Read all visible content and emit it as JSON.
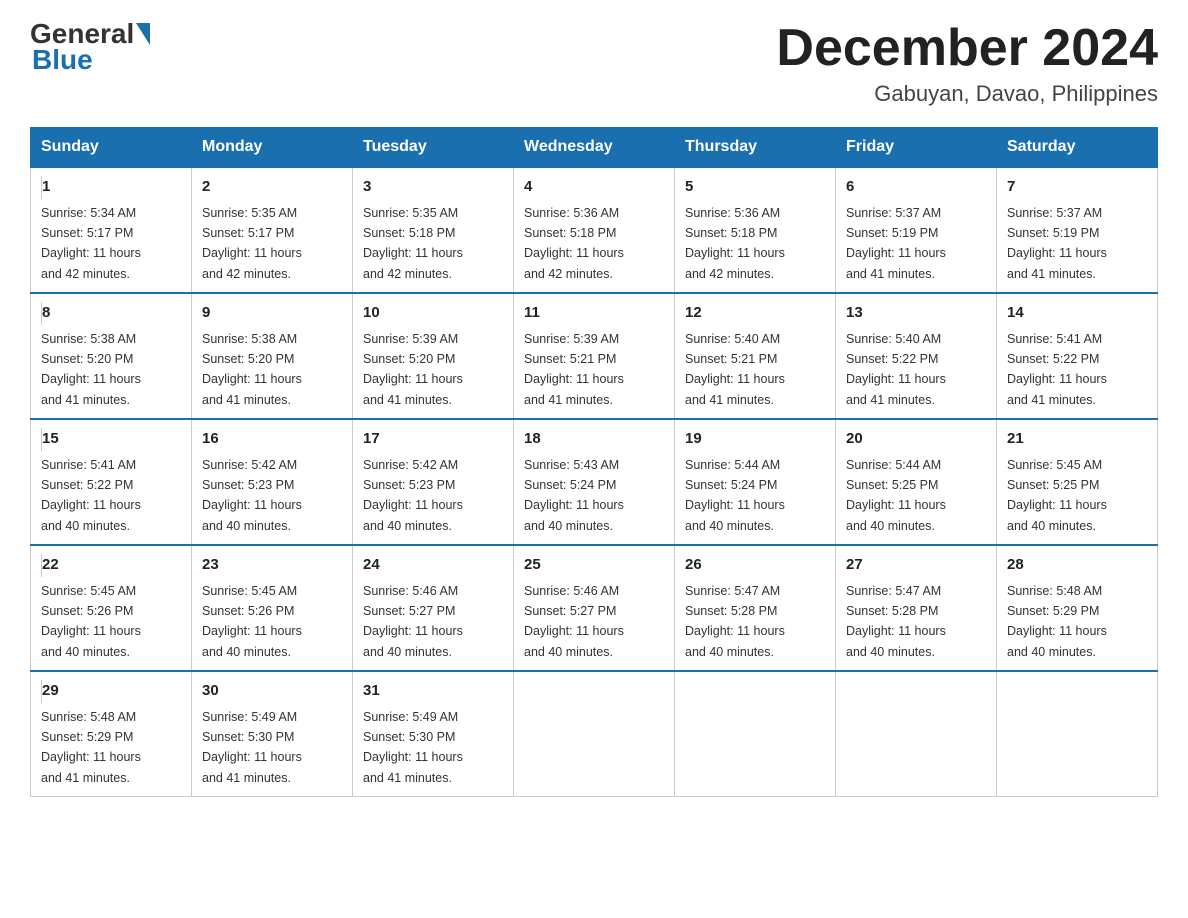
{
  "logo": {
    "general": "General",
    "blue": "Blue"
  },
  "title": "December 2024",
  "location": "Gabuyan, Davao, Philippines",
  "days_of_week": [
    "Sunday",
    "Monday",
    "Tuesday",
    "Wednesday",
    "Thursday",
    "Friday",
    "Saturday"
  ],
  "weeks": [
    [
      {
        "day": "1",
        "sunrise": "5:34 AM",
        "sunset": "5:17 PM",
        "daylight": "11 hours and 42 minutes."
      },
      {
        "day": "2",
        "sunrise": "5:35 AM",
        "sunset": "5:17 PM",
        "daylight": "11 hours and 42 minutes."
      },
      {
        "day": "3",
        "sunrise": "5:35 AM",
        "sunset": "5:18 PM",
        "daylight": "11 hours and 42 minutes."
      },
      {
        "day": "4",
        "sunrise": "5:36 AM",
        "sunset": "5:18 PM",
        "daylight": "11 hours and 42 minutes."
      },
      {
        "day": "5",
        "sunrise": "5:36 AM",
        "sunset": "5:18 PM",
        "daylight": "11 hours and 42 minutes."
      },
      {
        "day": "6",
        "sunrise": "5:37 AM",
        "sunset": "5:19 PM",
        "daylight": "11 hours and 41 minutes."
      },
      {
        "day": "7",
        "sunrise": "5:37 AM",
        "sunset": "5:19 PM",
        "daylight": "11 hours and 41 minutes."
      }
    ],
    [
      {
        "day": "8",
        "sunrise": "5:38 AM",
        "sunset": "5:20 PM",
        "daylight": "11 hours and 41 minutes."
      },
      {
        "day": "9",
        "sunrise": "5:38 AM",
        "sunset": "5:20 PM",
        "daylight": "11 hours and 41 minutes."
      },
      {
        "day": "10",
        "sunrise": "5:39 AM",
        "sunset": "5:20 PM",
        "daylight": "11 hours and 41 minutes."
      },
      {
        "day": "11",
        "sunrise": "5:39 AM",
        "sunset": "5:21 PM",
        "daylight": "11 hours and 41 minutes."
      },
      {
        "day": "12",
        "sunrise": "5:40 AM",
        "sunset": "5:21 PM",
        "daylight": "11 hours and 41 minutes."
      },
      {
        "day": "13",
        "sunrise": "5:40 AM",
        "sunset": "5:22 PM",
        "daylight": "11 hours and 41 minutes."
      },
      {
        "day": "14",
        "sunrise": "5:41 AM",
        "sunset": "5:22 PM",
        "daylight": "11 hours and 41 minutes."
      }
    ],
    [
      {
        "day": "15",
        "sunrise": "5:41 AM",
        "sunset": "5:22 PM",
        "daylight": "11 hours and 40 minutes."
      },
      {
        "day": "16",
        "sunrise": "5:42 AM",
        "sunset": "5:23 PM",
        "daylight": "11 hours and 40 minutes."
      },
      {
        "day": "17",
        "sunrise": "5:42 AM",
        "sunset": "5:23 PM",
        "daylight": "11 hours and 40 minutes."
      },
      {
        "day": "18",
        "sunrise": "5:43 AM",
        "sunset": "5:24 PM",
        "daylight": "11 hours and 40 minutes."
      },
      {
        "day": "19",
        "sunrise": "5:44 AM",
        "sunset": "5:24 PM",
        "daylight": "11 hours and 40 minutes."
      },
      {
        "day": "20",
        "sunrise": "5:44 AM",
        "sunset": "5:25 PM",
        "daylight": "11 hours and 40 minutes."
      },
      {
        "day": "21",
        "sunrise": "5:45 AM",
        "sunset": "5:25 PM",
        "daylight": "11 hours and 40 minutes."
      }
    ],
    [
      {
        "day": "22",
        "sunrise": "5:45 AM",
        "sunset": "5:26 PM",
        "daylight": "11 hours and 40 minutes."
      },
      {
        "day": "23",
        "sunrise": "5:45 AM",
        "sunset": "5:26 PM",
        "daylight": "11 hours and 40 minutes."
      },
      {
        "day": "24",
        "sunrise": "5:46 AM",
        "sunset": "5:27 PM",
        "daylight": "11 hours and 40 minutes."
      },
      {
        "day": "25",
        "sunrise": "5:46 AM",
        "sunset": "5:27 PM",
        "daylight": "11 hours and 40 minutes."
      },
      {
        "day": "26",
        "sunrise": "5:47 AM",
        "sunset": "5:28 PM",
        "daylight": "11 hours and 40 minutes."
      },
      {
        "day": "27",
        "sunrise": "5:47 AM",
        "sunset": "5:28 PM",
        "daylight": "11 hours and 40 minutes."
      },
      {
        "day": "28",
        "sunrise": "5:48 AM",
        "sunset": "5:29 PM",
        "daylight": "11 hours and 40 minutes."
      }
    ],
    [
      {
        "day": "29",
        "sunrise": "5:48 AM",
        "sunset": "5:29 PM",
        "daylight": "11 hours and 41 minutes."
      },
      {
        "day": "30",
        "sunrise": "5:49 AM",
        "sunset": "5:30 PM",
        "daylight": "11 hours and 41 minutes."
      },
      {
        "day": "31",
        "sunrise": "5:49 AM",
        "sunset": "5:30 PM",
        "daylight": "11 hours and 41 minutes."
      },
      null,
      null,
      null,
      null
    ]
  ],
  "labels": {
    "sunrise": "Sunrise:",
    "sunset": "Sunset:",
    "daylight": "Daylight:"
  }
}
